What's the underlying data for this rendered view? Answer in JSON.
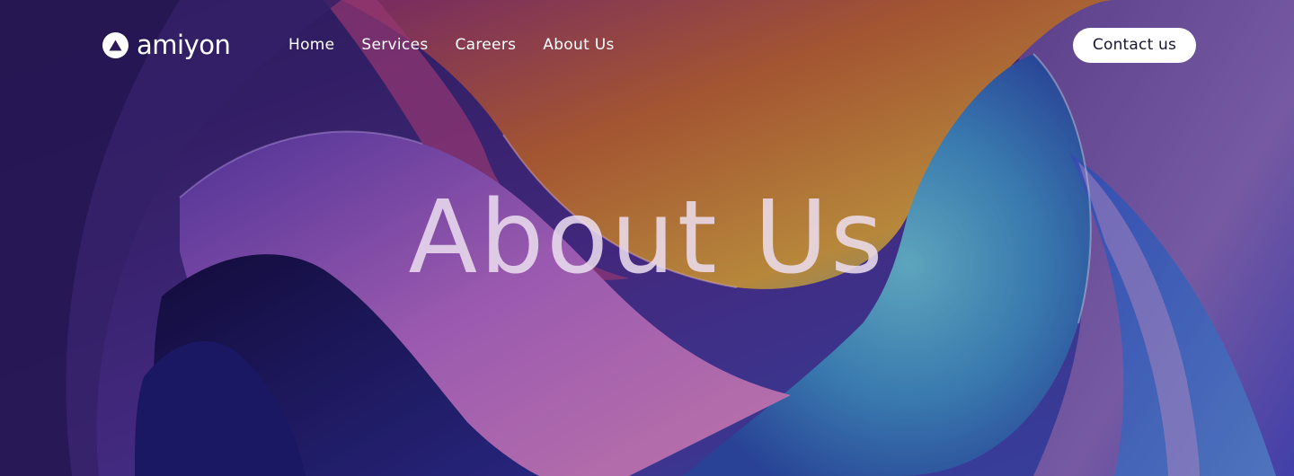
{
  "brand": {
    "name": "amiyon",
    "logo_icon": "triangle-in-circle-icon"
  },
  "nav": {
    "links": [
      {
        "label": "Home"
      },
      {
        "label": "Services"
      },
      {
        "label": "Careers"
      },
      {
        "label": "About Us"
      }
    ],
    "cta_label": "Contact us"
  },
  "hero": {
    "title": "About Us",
    "background": "abstract-gradient-waves",
    "colors": {
      "purple": "#3a1f7a",
      "magenta": "#c0569b",
      "orange": "#d98a2b",
      "teal": "#4fa8c8",
      "blue": "#2f5fc0"
    }
  }
}
